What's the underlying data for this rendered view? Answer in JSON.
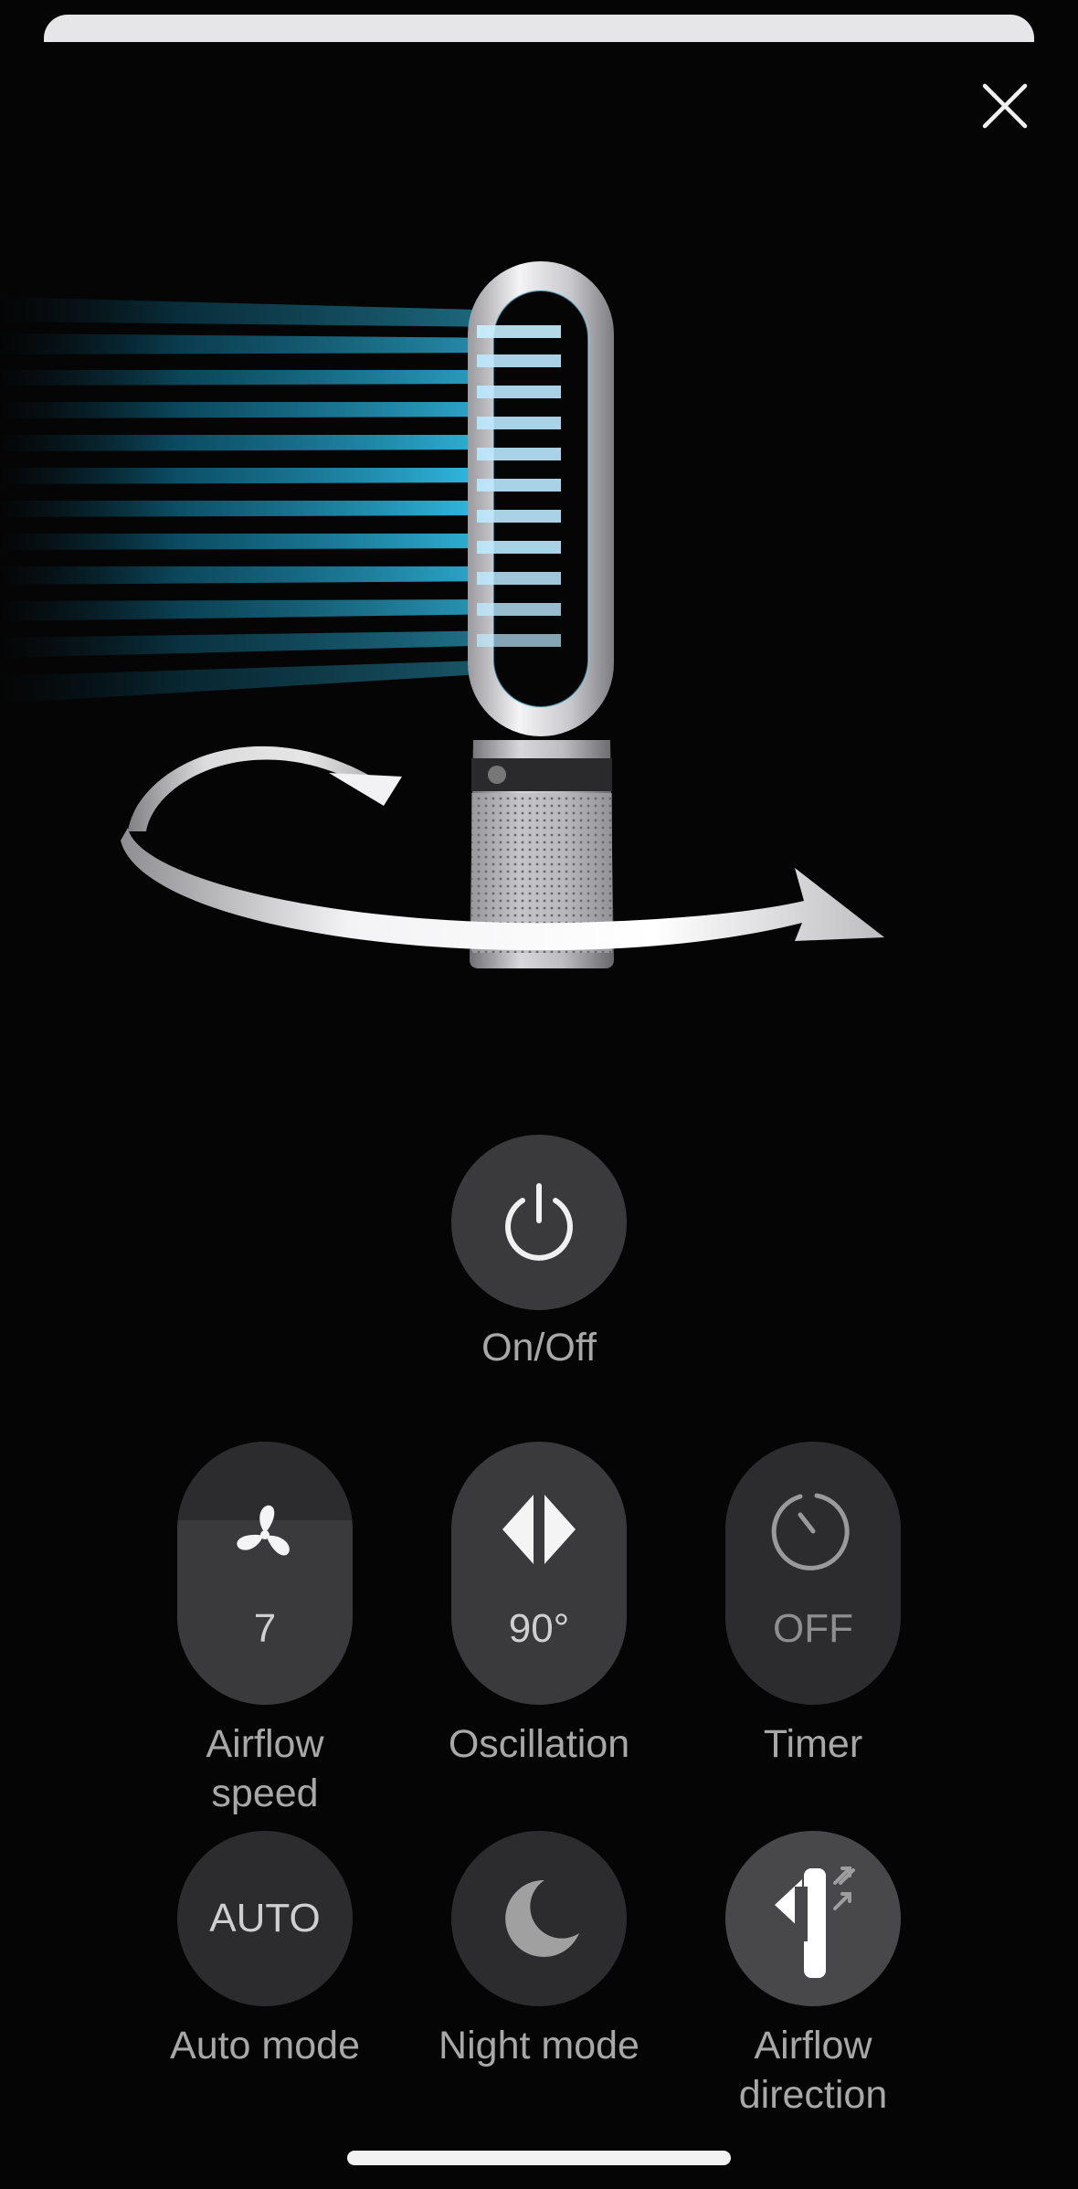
{
  "close": {
    "icon": "close-icon"
  },
  "hero": {
    "image": "air-purifier-fan-oscillation-illustration"
  },
  "controls": {
    "power": {
      "label": "On/Off",
      "icon": "power-icon"
    },
    "airflow_speed": {
      "label": "Airflow\nspeed",
      "value": "7",
      "icon": "fan-icon",
      "level_fraction": 0.7
    },
    "oscillation": {
      "label": "Oscillation",
      "value": "90°",
      "icon": "oscillation-icon"
    },
    "timer": {
      "label": "Timer",
      "value": "OFF",
      "icon": "timer-icon"
    },
    "auto_mode": {
      "label": "Auto mode",
      "value": "AUTO"
    },
    "night_mode": {
      "label": "Night mode",
      "icon": "moon-icon"
    },
    "airflow_direction": {
      "label": "Airflow\ndirection",
      "icon": "airflow-direction-icon"
    }
  },
  "colors": {
    "background": "#050505",
    "button": "#3a3a3c",
    "button_light": "#48484a",
    "text": "#a8a8a8",
    "airflow": "#2bb8e6"
  }
}
